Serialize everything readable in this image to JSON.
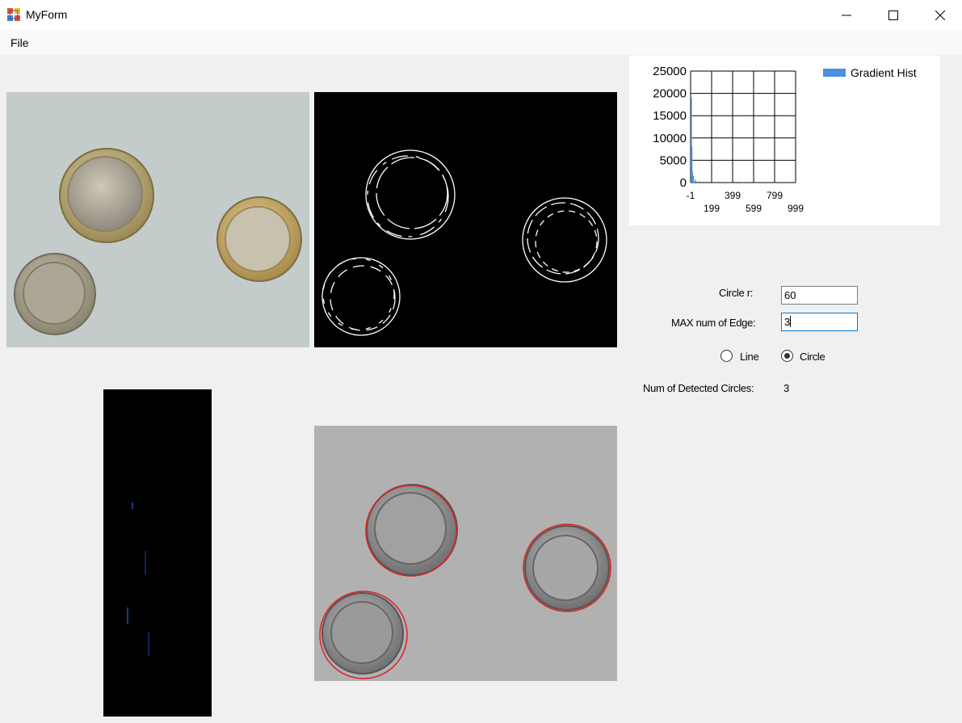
{
  "window": {
    "title": "MyForm"
  },
  "menu": {
    "file_label": "File"
  },
  "controls": {
    "circle_r_label": "Circle r:",
    "circle_r_value": "60",
    "max_edge_label": "MAX num of Edge:",
    "max_edge_value": "3",
    "radio_line_label": "Line",
    "radio_circle_label": "Circle",
    "selected_mode": "Circle",
    "detected_label": "Num of Detected Circles:",
    "detected_value": "3"
  },
  "chart_data": {
    "type": "bar",
    "series": [
      {
        "name": "Gradient Hist",
        "color": "#4a90e2",
        "values": [
          [
            0,
            19000
          ],
          [
            5,
            8000
          ],
          [
            10,
            2500
          ],
          [
            20,
            1500
          ],
          [
            40,
            600
          ],
          [
            80,
            300
          ],
          [
            150,
            250
          ],
          [
            250,
            200
          ],
          [
            350,
            150
          ],
          [
            500,
            100
          ],
          [
            700,
            50
          ]
        ]
      }
    ],
    "xlim": [
      -1,
      999
    ],
    "ylim": [
      0,
      25000
    ],
    "xticks_top": [
      "-1",
      "399",
      "799"
    ],
    "xticks_bottom": [
      "199",
      "599",
      "999"
    ],
    "yticks": [
      "25000",
      "20000",
      "15000",
      "10000",
      "5000",
      "0"
    ],
    "grid": true,
    "legend": "top-right"
  }
}
